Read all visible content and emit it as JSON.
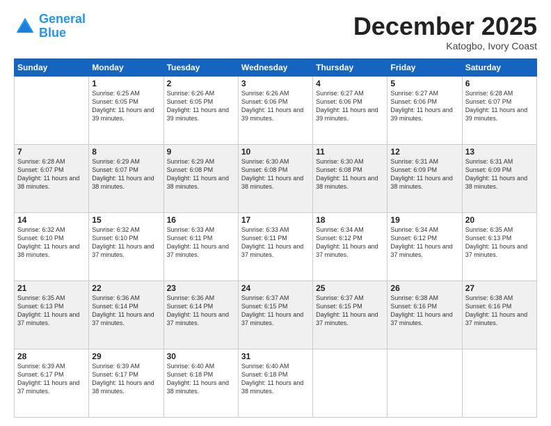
{
  "logo": {
    "line1": "General",
    "line2": "Blue"
  },
  "header": {
    "month": "December 2025",
    "location": "Katogbo, Ivory Coast"
  },
  "days": [
    "Sunday",
    "Monday",
    "Tuesday",
    "Wednesday",
    "Thursday",
    "Friday",
    "Saturday"
  ],
  "weeks": [
    [
      {
        "day": "",
        "sunrise": "",
        "sunset": "",
        "daylight": ""
      },
      {
        "day": "1",
        "sunrise": "Sunrise: 6:25 AM",
        "sunset": "Sunset: 6:05 PM",
        "daylight": "Daylight: 11 hours and 39 minutes."
      },
      {
        "day": "2",
        "sunrise": "Sunrise: 6:26 AM",
        "sunset": "Sunset: 6:05 PM",
        "daylight": "Daylight: 11 hours and 39 minutes."
      },
      {
        "day": "3",
        "sunrise": "Sunrise: 6:26 AM",
        "sunset": "Sunset: 6:06 PM",
        "daylight": "Daylight: 11 hours and 39 minutes."
      },
      {
        "day": "4",
        "sunrise": "Sunrise: 6:27 AM",
        "sunset": "Sunset: 6:06 PM",
        "daylight": "Daylight: 11 hours and 39 minutes."
      },
      {
        "day": "5",
        "sunrise": "Sunrise: 6:27 AM",
        "sunset": "Sunset: 6:06 PM",
        "daylight": "Daylight: 11 hours and 39 minutes."
      },
      {
        "day": "6",
        "sunrise": "Sunrise: 6:28 AM",
        "sunset": "Sunset: 6:07 PM",
        "daylight": "Daylight: 11 hours and 39 minutes."
      }
    ],
    [
      {
        "day": "7",
        "sunrise": "Sunrise: 6:28 AM",
        "sunset": "Sunset: 6:07 PM",
        "daylight": "Daylight: 11 hours and 38 minutes."
      },
      {
        "day": "8",
        "sunrise": "Sunrise: 6:29 AM",
        "sunset": "Sunset: 6:07 PM",
        "daylight": "Daylight: 11 hours and 38 minutes."
      },
      {
        "day": "9",
        "sunrise": "Sunrise: 6:29 AM",
        "sunset": "Sunset: 6:08 PM",
        "daylight": "Daylight: 11 hours and 38 minutes."
      },
      {
        "day": "10",
        "sunrise": "Sunrise: 6:30 AM",
        "sunset": "Sunset: 6:08 PM",
        "daylight": "Daylight: 11 hours and 38 minutes."
      },
      {
        "day": "11",
        "sunrise": "Sunrise: 6:30 AM",
        "sunset": "Sunset: 6:08 PM",
        "daylight": "Daylight: 11 hours and 38 minutes."
      },
      {
        "day": "12",
        "sunrise": "Sunrise: 6:31 AM",
        "sunset": "Sunset: 6:09 PM",
        "daylight": "Daylight: 11 hours and 38 minutes."
      },
      {
        "day": "13",
        "sunrise": "Sunrise: 6:31 AM",
        "sunset": "Sunset: 6:09 PM",
        "daylight": "Daylight: 11 hours and 38 minutes."
      }
    ],
    [
      {
        "day": "14",
        "sunrise": "Sunrise: 6:32 AM",
        "sunset": "Sunset: 6:10 PM",
        "daylight": "Daylight: 11 hours and 38 minutes."
      },
      {
        "day": "15",
        "sunrise": "Sunrise: 6:32 AM",
        "sunset": "Sunset: 6:10 PM",
        "daylight": "Daylight: 11 hours and 37 minutes."
      },
      {
        "day": "16",
        "sunrise": "Sunrise: 6:33 AM",
        "sunset": "Sunset: 6:11 PM",
        "daylight": "Daylight: 11 hours and 37 minutes."
      },
      {
        "day": "17",
        "sunrise": "Sunrise: 6:33 AM",
        "sunset": "Sunset: 6:11 PM",
        "daylight": "Daylight: 11 hours and 37 minutes."
      },
      {
        "day": "18",
        "sunrise": "Sunrise: 6:34 AM",
        "sunset": "Sunset: 6:12 PM",
        "daylight": "Daylight: 11 hours and 37 minutes."
      },
      {
        "day": "19",
        "sunrise": "Sunrise: 6:34 AM",
        "sunset": "Sunset: 6:12 PM",
        "daylight": "Daylight: 11 hours and 37 minutes."
      },
      {
        "day": "20",
        "sunrise": "Sunrise: 6:35 AM",
        "sunset": "Sunset: 6:13 PM",
        "daylight": "Daylight: 11 hours and 37 minutes."
      }
    ],
    [
      {
        "day": "21",
        "sunrise": "Sunrise: 6:35 AM",
        "sunset": "Sunset: 6:13 PM",
        "daylight": "Daylight: 11 hours and 37 minutes."
      },
      {
        "day": "22",
        "sunrise": "Sunrise: 6:36 AM",
        "sunset": "Sunset: 6:14 PM",
        "daylight": "Daylight: 11 hours and 37 minutes."
      },
      {
        "day": "23",
        "sunrise": "Sunrise: 6:36 AM",
        "sunset": "Sunset: 6:14 PM",
        "daylight": "Daylight: 11 hours and 37 minutes."
      },
      {
        "day": "24",
        "sunrise": "Sunrise: 6:37 AM",
        "sunset": "Sunset: 6:15 PM",
        "daylight": "Daylight: 11 hours and 37 minutes."
      },
      {
        "day": "25",
        "sunrise": "Sunrise: 6:37 AM",
        "sunset": "Sunset: 6:15 PM",
        "daylight": "Daylight: 11 hours and 37 minutes."
      },
      {
        "day": "26",
        "sunrise": "Sunrise: 6:38 AM",
        "sunset": "Sunset: 6:16 PM",
        "daylight": "Daylight: 11 hours and 37 minutes."
      },
      {
        "day": "27",
        "sunrise": "Sunrise: 6:38 AM",
        "sunset": "Sunset: 6:16 PM",
        "daylight": "Daylight: 11 hours and 37 minutes."
      }
    ],
    [
      {
        "day": "28",
        "sunrise": "Sunrise: 6:39 AM",
        "sunset": "Sunset: 6:17 PM",
        "daylight": "Daylight: 11 hours and 37 minutes."
      },
      {
        "day": "29",
        "sunrise": "Sunrise: 6:39 AM",
        "sunset": "Sunset: 6:17 PM",
        "daylight": "Daylight: 11 hours and 38 minutes."
      },
      {
        "day": "30",
        "sunrise": "Sunrise: 6:40 AM",
        "sunset": "Sunset: 6:18 PM",
        "daylight": "Daylight: 11 hours and 38 minutes."
      },
      {
        "day": "31",
        "sunrise": "Sunrise: 6:40 AM",
        "sunset": "Sunset: 6:18 PM",
        "daylight": "Daylight: 11 hours and 38 minutes."
      },
      {
        "day": "",
        "sunrise": "",
        "sunset": "",
        "daylight": ""
      },
      {
        "day": "",
        "sunrise": "",
        "sunset": "",
        "daylight": ""
      },
      {
        "day": "",
        "sunrise": "",
        "sunset": "",
        "daylight": ""
      }
    ]
  ]
}
